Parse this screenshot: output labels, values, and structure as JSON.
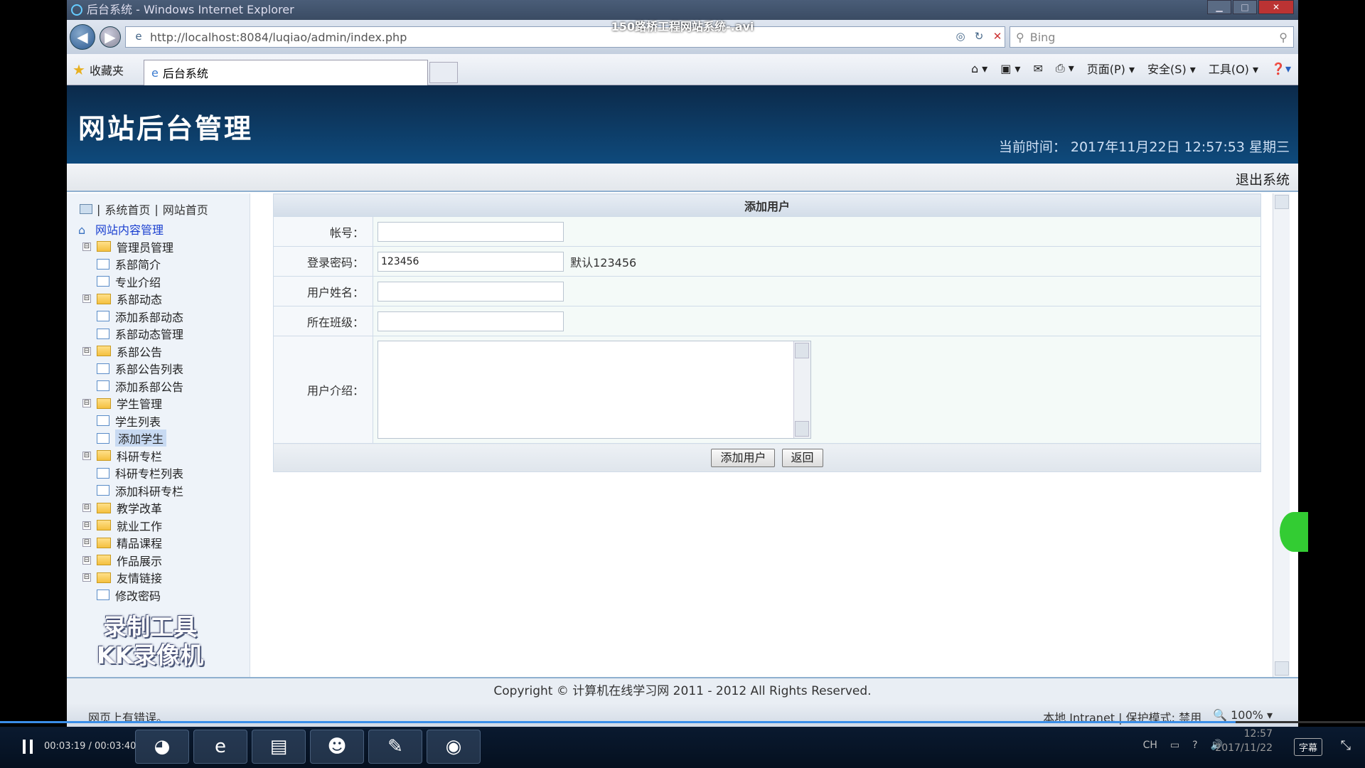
{
  "video": {
    "title": "150路桥工程网站系统-.avi",
    "current_time": "00:03:19",
    "total_time": "00:03:40",
    "progress": 0.905,
    "subtitle_btn": "字幕",
    "clock_time": "12:57",
    "clock_date": "2017/11/22",
    "tray_lang": "CH"
  },
  "browser": {
    "window_title": "后台系统 - Windows Internet Explorer",
    "url": "http://localhost:8084/luqiao/admin/index.php",
    "search_placeholder": "Bing",
    "favorites": "收藏夹",
    "tab_title": "后台系统",
    "cmd": {
      "page": "页面(P)",
      "safety": "安全(S)",
      "tools": "工具(O)"
    },
    "status_left": "网页上有错误。",
    "status_zone": "本地 Intranet | 保护模式: 禁用",
    "zoom": "100%"
  },
  "site": {
    "banner_title": "网站后台管理",
    "time_label": "当前时间：",
    "time_value": "2017年11月22日 12:57:53 星期三",
    "logout": "退出系统",
    "footer": "Copyright © 计算机在线学习网  2011 - 2012 All Rights Reserved."
  },
  "sidebar": {
    "top_links": {
      "sys_home": "系统首页",
      "site_home": "网站首页"
    },
    "root": "网站内容管理",
    "items": [
      {
        "label": "管理员管理",
        "type": "folder",
        "level": 1
      },
      {
        "label": "系部简介",
        "type": "doc",
        "level": 1
      },
      {
        "label": "专业介绍",
        "type": "doc",
        "level": 1
      },
      {
        "label": "系部动态",
        "type": "folder",
        "level": 1
      },
      {
        "label": "添加系部动态",
        "type": "doc",
        "level": 2
      },
      {
        "label": "系部动态管理",
        "type": "doc",
        "level": 2
      },
      {
        "label": "系部公告",
        "type": "folder",
        "level": 1
      },
      {
        "label": "系部公告列表",
        "type": "doc",
        "level": 2
      },
      {
        "label": "添加系部公告",
        "type": "doc",
        "level": 2
      },
      {
        "label": "学生管理",
        "type": "folder",
        "level": 1
      },
      {
        "label": "学生列表",
        "type": "doc",
        "level": 2
      },
      {
        "label": "添加学生",
        "type": "doc",
        "level": 2,
        "selected": true
      },
      {
        "label": "科研专栏",
        "type": "folder",
        "level": 1
      },
      {
        "label": "科研专栏列表",
        "type": "doc",
        "level": 2
      },
      {
        "label": "添加科研专栏",
        "type": "doc",
        "level": 2
      },
      {
        "label": "教学改革",
        "type": "folder",
        "level": 1
      },
      {
        "label": "就业工作",
        "type": "folder",
        "level": 1
      },
      {
        "label": "精品课程",
        "type": "folder",
        "level": 1
      },
      {
        "label": "作品展示",
        "type": "folder",
        "level": 1
      },
      {
        "label": "友情链接",
        "type": "folder",
        "level": 1
      },
      {
        "label": "修改密码",
        "type": "doc",
        "level": 1
      }
    ],
    "watermark_line1": "录制工具",
    "watermark_line2": "KK录像机"
  },
  "form": {
    "heading": "添加用户",
    "fields": {
      "account": {
        "label": "帐号：",
        "value": ""
      },
      "password": {
        "label": "登录密码：",
        "value": "123456",
        "hint": "默认123456"
      },
      "name": {
        "label": "用户姓名：",
        "value": ""
      },
      "class": {
        "label": "所在班级：",
        "value": ""
      },
      "intro": {
        "label": "用户介绍：",
        "value": ""
      }
    },
    "submit": "添加用户",
    "back": "返回"
  }
}
